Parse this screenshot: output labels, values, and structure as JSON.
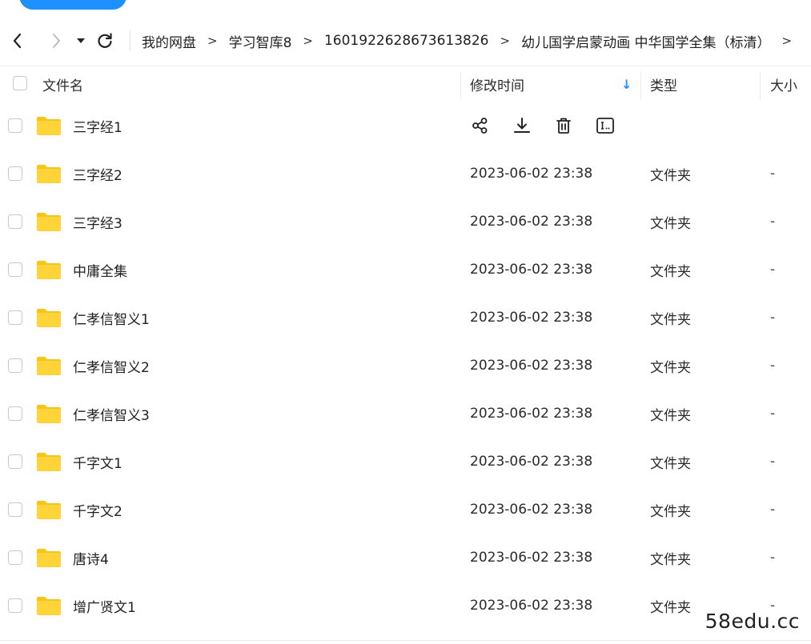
{
  "breadcrumb": {
    "items": [
      "我的网盘",
      "学习智库8",
      "1601922628673613826",
      "幼儿国学启蒙动画 中华国学全集（标清）"
    ],
    "separator": ">"
  },
  "table": {
    "headers": {
      "name": "文件名",
      "modified": "修改时间",
      "type": "类型",
      "size": "大小"
    },
    "sort_indicator": "↓",
    "rows": [
      {
        "name": "三字经1",
        "modified": "",
        "type": "",
        "size": "",
        "hovered": true
      },
      {
        "name": "三字经2",
        "modified": "2023-06-02 23:38",
        "type": "文件夹",
        "size": "-"
      },
      {
        "name": "三字经3",
        "modified": "2023-06-02 23:38",
        "type": "文件夹",
        "size": "-"
      },
      {
        "name": "中庸全集",
        "modified": "2023-06-02 23:38",
        "type": "文件夹",
        "size": "-"
      },
      {
        "name": "仁孝信智义1",
        "modified": "2023-06-02 23:38",
        "type": "文件夹",
        "size": "-"
      },
      {
        "name": "仁孝信智义2",
        "modified": "2023-06-02 23:38",
        "type": "文件夹",
        "size": "-"
      },
      {
        "name": "仁孝信智义3",
        "modified": "2023-06-02 23:38",
        "type": "文件夹",
        "size": "-"
      },
      {
        "name": "千字文1",
        "modified": "2023-06-02 23:38",
        "type": "文件夹",
        "size": "-"
      },
      {
        "name": "千字文2",
        "modified": "2023-06-02 23:38",
        "type": "文件夹",
        "size": "-"
      },
      {
        "name": "唐诗4",
        "modified": "2023-06-02 23:38",
        "type": "文件夹",
        "size": "-"
      },
      {
        "name": "增广贤文1",
        "modified": "2023-06-02 23:38",
        "type": "文件夹",
        "size": "-"
      }
    ],
    "row_actions": [
      "share-icon",
      "download-icon",
      "delete-icon",
      "rename-icon"
    ]
  },
  "watermark": "58edu.cc",
  "colors": {
    "accent": "#1e90ff",
    "folder": "#ffd43b",
    "folder_tab": "#f5c518",
    "text": "#1f1f1f"
  }
}
